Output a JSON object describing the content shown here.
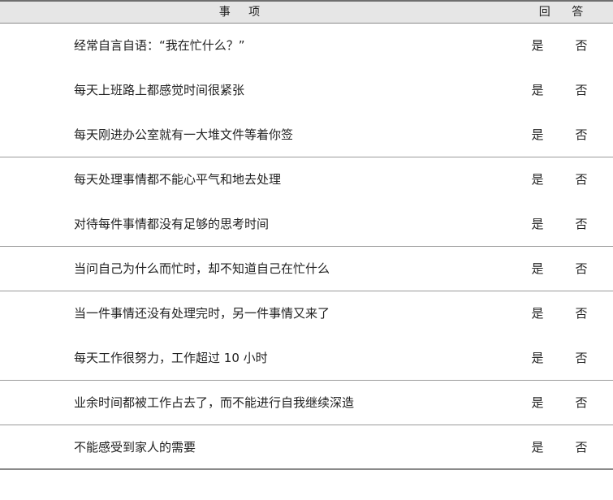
{
  "header": {
    "item_label": "事项",
    "answer_label": "回答"
  },
  "rows": [
    {
      "question": "经常自言自语：“我在忙什么？”",
      "yes": "是",
      "no": "否"
    },
    {
      "question": "每天上班路上都感觉时间很紧张",
      "yes": "是",
      "no": "否"
    },
    {
      "question": "每天刚进办公室就有一大堆文件等着你签",
      "yes": "是",
      "no": "否"
    },
    {
      "question": "每天处理事情都不能心平气和地去处理",
      "yes": "是",
      "no": "否"
    },
    {
      "question": "对待每件事情都没有足够的思考时间",
      "yes": "是",
      "no": "否"
    },
    {
      "question": "当问自己为什么而忙时，却不知道自己在忙什么",
      "yes": "是",
      "no": "否"
    },
    {
      "question": "当一件事情还没有处理完时，另一件事情又来了",
      "yes": "是",
      "no": "否"
    },
    {
      "question": "每天工作很努力，工作超过 10 小时",
      "yes": "是",
      "no": "否"
    },
    {
      "question": "业余时间都被工作占去了，而不能进行自我继续深造",
      "yes": "是",
      "no": "否"
    },
    {
      "question": "不能感受到家人的需要",
      "yes": "是",
      "no": "否"
    }
  ]
}
